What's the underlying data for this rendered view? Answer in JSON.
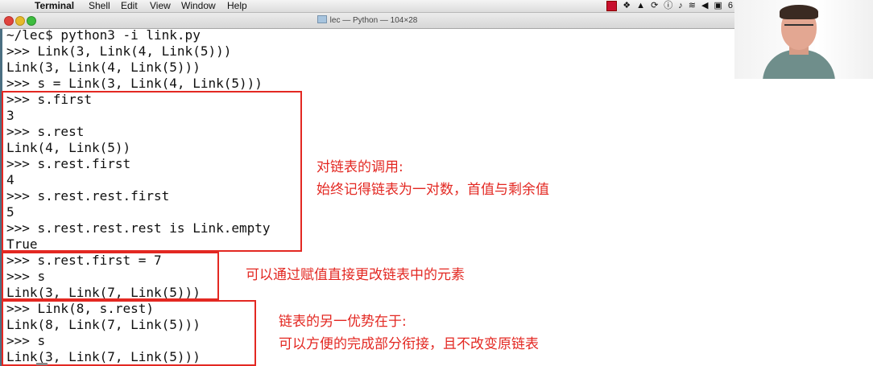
{
  "menubar": {
    "apple": "",
    "app_name": "Terminal",
    "items": [
      "Shell",
      "Edit",
      "View",
      "Window",
      "Help"
    ],
    "status_icons": [
      "battery-low-icon",
      "dropbox-icon",
      "drive-icon",
      "sync-icon",
      "info-icon",
      "bell-icon",
      "wifi-icon",
      "volume-icon",
      "display-icon"
    ],
    "status_trailing": "6"
  },
  "window": {
    "title": "lec — Python — 104×28"
  },
  "terminal": {
    "lines": [
      "~/lec$ python3 -i link.py",
      ">>> Link(3, Link(4, Link(5)))",
      "Link(3, Link(4, Link(5)))",
      ">>> s = Link(3, Link(4, Link(5)))",
      ">>> s.first",
      "3",
      ">>> s.rest",
      "Link(4, Link(5))",
      ">>> s.rest.first",
      "4",
      ">>> s.rest.rest.first",
      "5",
      ">>> s.rest.rest.rest is Link.empty",
      "True",
      ">>> s.rest.first = 7",
      ">>> s",
      "Link(3, Link(7, Link(5)))",
      ">>> Link(8, s.rest)",
      "Link(8, Link(7, Link(5)))",
      ">>> s",
      "Link(3, Link(7, Link(5)))"
    ]
  },
  "annotations": {
    "note1_line1": "对链表的调用:",
    "note1_line2": "始终记得链表为一对数，首值与剩余值",
    "note2": "可以通过赋值直接更改链表中的元素",
    "note3_line1": "链表的另一优势在于:",
    "note3_line2": "可以方便的完成部分衔接，且不改变原链表",
    "highlight_color": "#e32822"
  },
  "webcam": {
    "label": "presenter-video"
  }
}
